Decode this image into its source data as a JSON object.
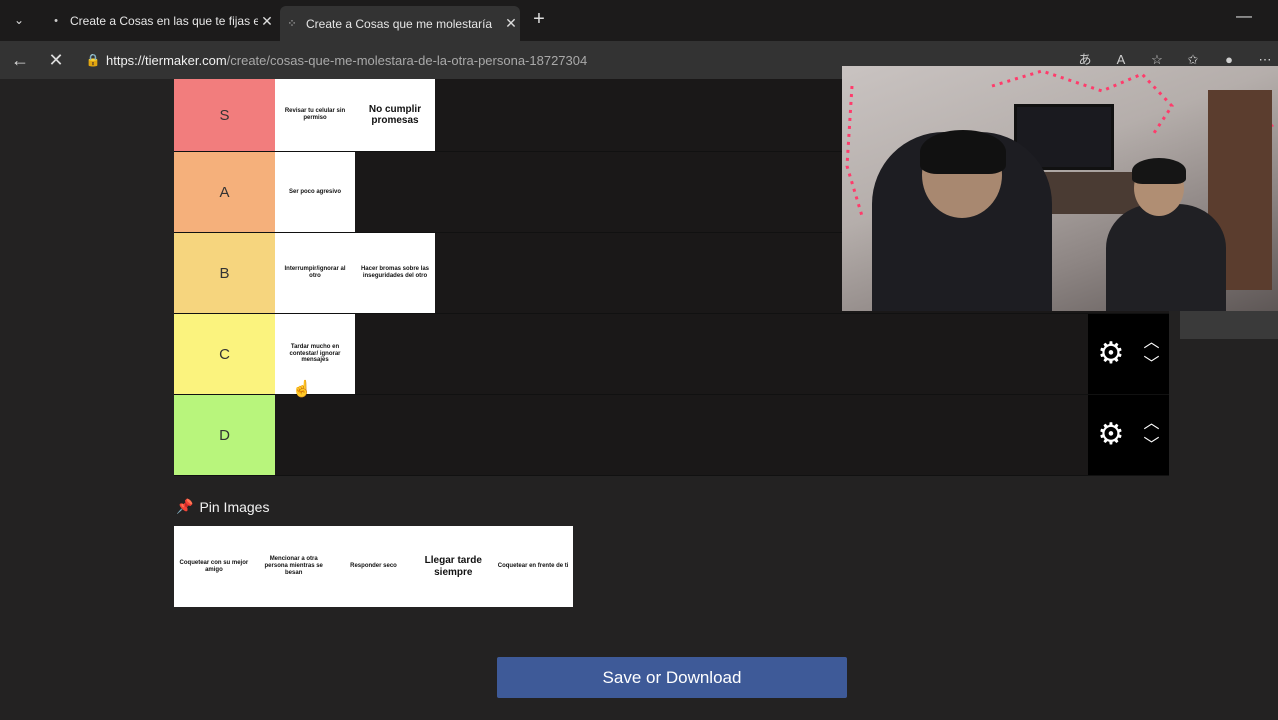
{
  "browser": {
    "tabs": [
      {
        "title": "Create a Cosas en las que te fijas e",
        "favicon": "•"
      },
      {
        "title": "Create a Cosas que me molestaría",
        "favicon": "⁘"
      }
    ],
    "url_host": "https://tiermaker.com",
    "url_path": "/create/cosas-que-me-molestara-de-la-otra-persona-18727304"
  },
  "tiers": [
    {
      "label": "S",
      "color": "#f27d7d",
      "items": [
        "Revisar tu celular sin permiso",
        "No cumplir promesas"
      ]
    },
    {
      "label": "A",
      "color": "#f5b07b",
      "items": [
        "Ser poco agresivo"
      ]
    },
    {
      "label": "B",
      "color": "#f6d57e",
      "items": [
        "Interrumpir/ignorar al otro",
        "Hacer bromas sobre las inseguridades del otro"
      ]
    },
    {
      "label": "C",
      "color": "#fbf37e",
      "items": [
        "Tardar mucho en contestar/ ignorar mensajes"
      ]
    },
    {
      "label": "D",
      "color": "#b8f57c",
      "items": []
    }
  ],
  "pin": {
    "title": "Pin Images",
    "items": [
      "Coquetear con su mejor amigo",
      "Mencionar a otra persona mientras se besan",
      "Responder seco",
      "Llegar tarde siempre",
      "Coquetear en frente de ti"
    ]
  },
  "save_label": "Save or Download"
}
